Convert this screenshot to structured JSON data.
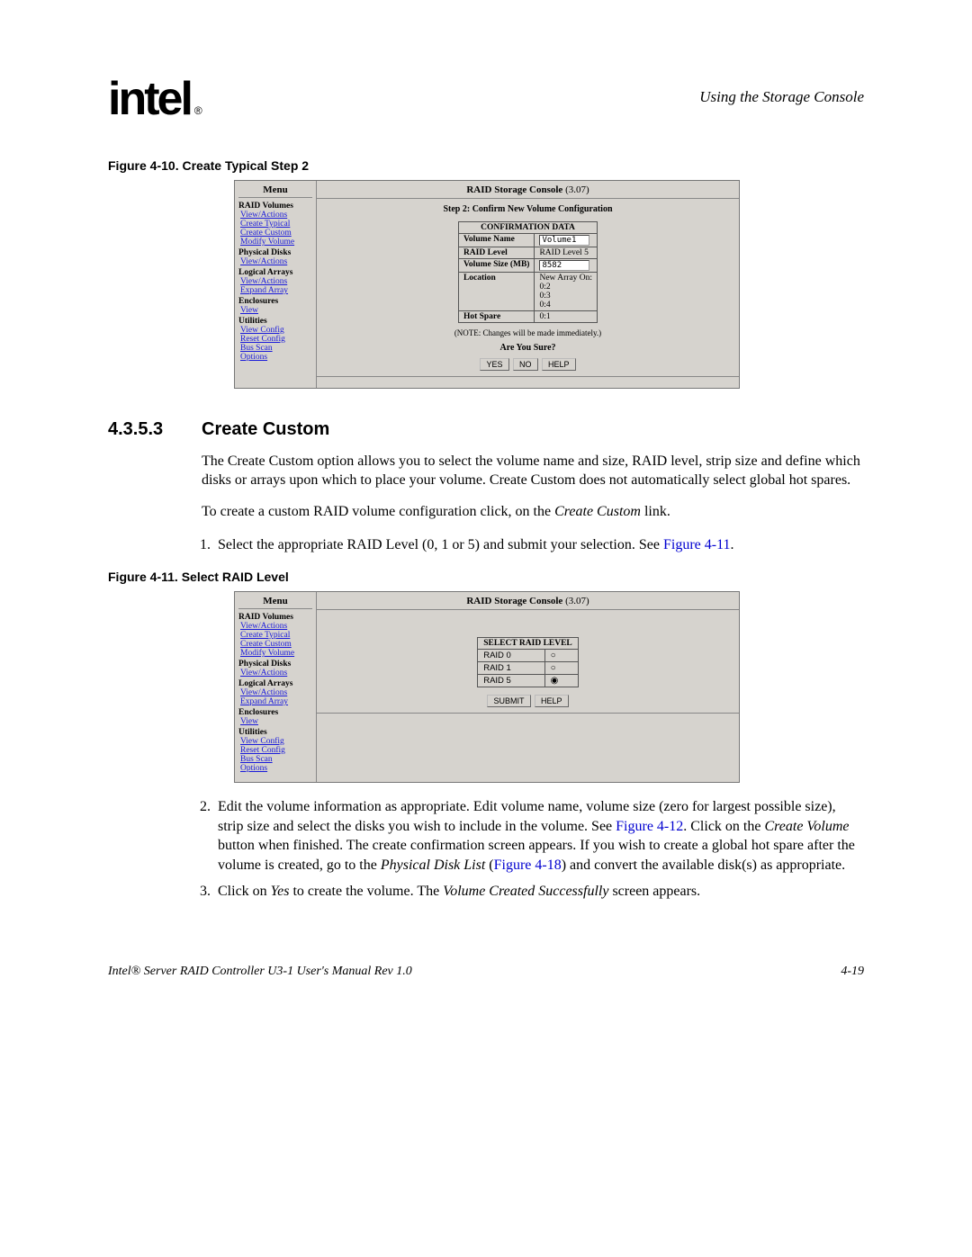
{
  "header": {
    "logo_text": "intel",
    "reg": "®",
    "running_head": "Using the Storage Console"
  },
  "fig410": {
    "caption": "Figure 4-10. Create Typical Step 2",
    "menu_title": "Menu",
    "console_title_bold": "RAID Storage Console",
    "console_title_ver": "(3.07)",
    "step_title": "Step 2: Confirm New Volume Configuration",
    "conf_header": "CONFIRMATION DATA",
    "rows": {
      "volname_label": "Volume Name",
      "volname_value": "Volume1",
      "raidlevel_label": "RAID Level",
      "raidlevel_value": "RAID Level 5",
      "volsize_label": "Volume Size (MB)",
      "volsize_value": "8582",
      "location_label": "Location",
      "location_value": "New Array On:\n0:2\n0:3\n0:4",
      "hotspare_label": "Hot Spare",
      "hotspare_value": "0:1"
    },
    "note": "(NOTE: Changes will be made immediately.)",
    "sure": "Are You Sure?",
    "btn_yes": "YES",
    "btn_no": "NO",
    "btn_help": "HELP"
  },
  "menu": {
    "cats": {
      "raid_volumes": "RAID Volumes",
      "physical_disks": "Physical Disks",
      "logical_arrays": "Logical Arrays",
      "enclosures": "Enclosures",
      "utilities": "Utilities"
    },
    "links": {
      "view_actions": "View/Actions",
      "create_typical": "Create Typical",
      "create_custom": "Create Custom",
      "modify_volume": "Modify Volume",
      "expand_array": "Expand Array",
      "view": "View",
      "view_config": "View Config",
      "reset_config": "Reset Config",
      "bus_scan": "Bus Scan",
      "options": "Options"
    }
  },
  "section": {
    "num": "4.3.5.3",
    "title": "Create Custom",
    "para1": "The Create Custom option allows you to select the volume name and size, RAID level, strip size and define which disks or arrays upon which to place your volume. Create Custom does not automatically select global hot spares.",
    "para2_pre": "To create a custom RAID volume configuration click, on the ",
    "para2_em": "Create Custom",
    "para2_post": " link.",
    "li1_pre": "Select the appropriate RAID Level (0, 1 or 5) and submit your selection. See ",
    "li1_link": "Figure 4-11",
    "li1_post": ".",
    "li2_a": "Edit the volume information as appropriate. Edit volume name, volume size (zero for largest possible size), strip size and select the disks you wish to include in the volume. See ",
    "li2_link1": "Figure 4-12",
    "li2_b": ". Click on the ",
    "li2_em1": "Create Volume",
    "li2_c": " button when finished. The create confirmation screen appears. If you wish to create a global hot spare after the volume is created, go to the ",
    "li2_em2": "Physical Disk List",
    "li2_d": " (",
    "li2_link2": "Figure 4-18",
    "li2_e": ") and convert the available disk(s) as appropriate.",
    "li3_a": "Click on ",
    "li3_em1": "Yes",
    "li3_b": " to create the volume. The ",
    "li3_em2": "Volume Created Successfully",
    "li3_c": " screen appears."
  },
  "fig411": {
    "caption": "Figure 4-11. Select RAID Level",
    "sel_header": "SELECT RAID LEVEL",
    "r0": "RAID 0",
    "r1": "RAID 1",
    "r5": "RAID 5",
    "btn_submit": "SUBMIT",
    "btn_help": "HELP"
  },
  "footer": {
    "left": "Intel® Server RAID Controller U3-1 User's Manual Rev 1.0",
    "right": "4-19"
  }
}
